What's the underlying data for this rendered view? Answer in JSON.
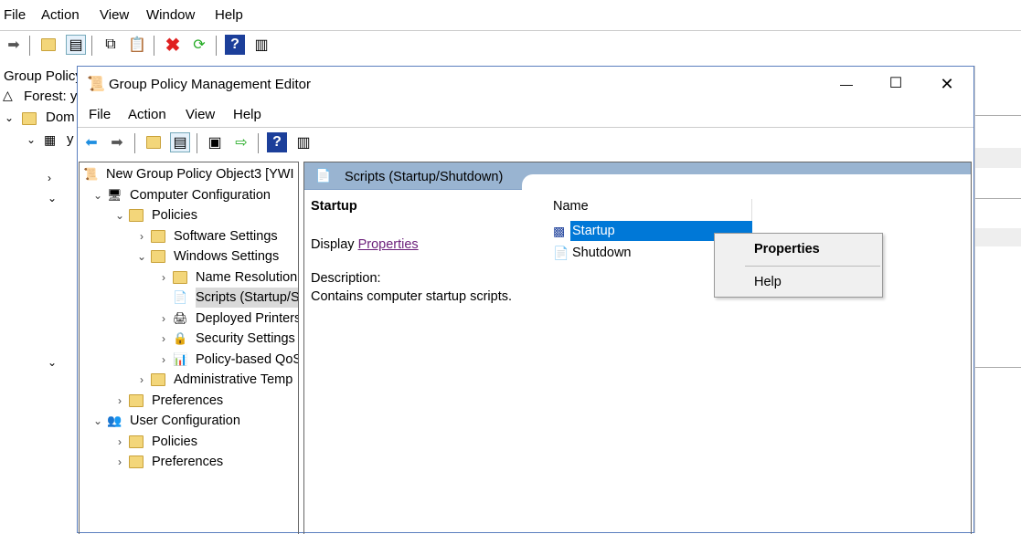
{
  "bg_app": {
    "menu": [
      "File",
      "Action",
      "View",
      "Window",
      "Help"
    ],
    "tree": [
      "Group Policy",
      "Forest: y",
      "Dom",
      "y"
    ]
  },
  "editor": {
    "title": "Group Policy Management Editor",
    "menu": [
      "File",
      "Action",
      "View",
      "Help"
    ],
    "tree": [
      {
        "label": "New Group Policy Object3 [YWI",
        "level": 0,
        "expander": "",
        "icon": "scroll-icon"
      },
      {
        "label": "Computer Configuration",
        "level": 1,
        "expander": "v",
        "icon": "computer-icon"
      },
      {
        "label": "Policies",
        "level": 2,
        "expander": "v",
        "icon": "folder-icon"
      },
      {
        "label": "Software Settings",
        "level": 3,
        "expander": ">",
        "icon": "folder-icon"
      },
      {
        "label": "Windows Settings",
        "level": 3,
        "expander": "v",
        "icon": "folder-icon"
      },
      {
        "label": "Name Resolution",
        "level": 4,
        "expander": ">",
        "icon": "folder-icon"
      },
      {
        "label": "Scripts (Startup/S",
        "level": 4,
        "expander": "",
        "icon": "script-icon",
        "selected": true
      },
      {
        "label": "Deployed Printers",
        "level": 4,
        "expander": ">",
        "icon": "printer-icon"
      },
      {
        "label": "Security Settings",
        "level": 4,
        "expander": ">",
        "icon": "security-icon"
      },
      {
        "label": "Policy-based QoS",
        "level": 4,
        "expander": ">",
        "icon": "chart-icon"
      },
      {
        "label": "Administrative Temp",
        "level": 3,
        "expander": ">",
        "icon": "folder-icon"
      },
      {
        "label": "Preferences",
        "level": 2,
        "expander": ">",
        "icon": "folder-icon"
      },
      {
        "label": "User Configuration",
        "level": 1,
        "expander": "v",
        "icon": "user-icon"
      },
      {
        "label": "Policies",
        "level": 2,
        "expander": ">",
        "icon": "folder-icon"
      },
      {
        "label": "Preferences",
        "level": 2,
        "expander": ">",
        "icon": "folder-icon"
      }
    ],
    "pane_header": "Scripts (Startup/Shutdown)",
    "detail": {
      "heading": "Startup",
      "display": "Display",
      "link": "Properties",
      "desc_label": "Description:",
      "desc": "Contains computer startup scripts."
    },
    "list": {
      "column": "Name",
      "items": [
        "Startup",
        "Shutdown"
      ],
      "selected": "Startup"
    },
    "context_menu": [
      "Properties",
      "Help"
    ]
  },
  "colors": {
    "selection": "#0078d7",
    "header_band": "#99b4d1"
  }
}
